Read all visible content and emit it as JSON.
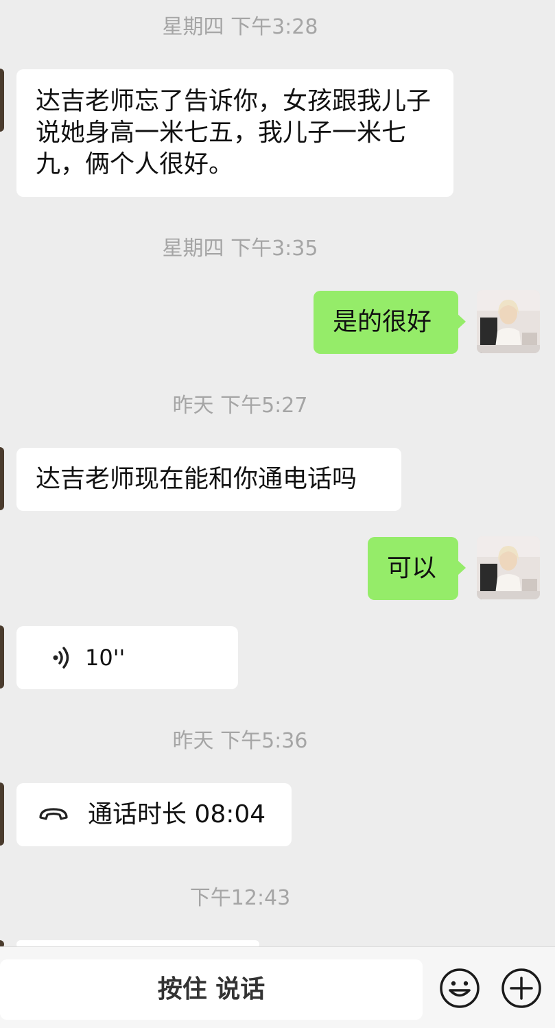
{
  "messages": {
    "ts1": "星期四 下午3:28",
    "msg1": "达吉老师忘了告诉你，女孩跟我儿子说她身高一米七五，我儿子一米七九，俩个人很好。",
    "ts2": "星期四 下午3:35",
    "msg2": "是的很好",
    "ts3": "昨天 下午5:27",
    "msg3": "达吉老师现在能和你通电话吗",
    "msg4": "可以",
    "voice_duration": "10''",
    "ts4": "昨天 下午5:36",
    "call_label": "通话时长 08:04",
    "ts5": "下午12:43"
  },
  "input_bar": {
    "voice_button": "按住 说话",
    "emoji_icon": "smiley-face",
    "plus_icon": "add-circle"
  },
  "colors": {
    "background": "#ededed",
    "incoming_bubble": "#ffffff",
    "outgoing_bubble": "#95ec69",
    "timestamp": "#a5a5a5"
  }
}
